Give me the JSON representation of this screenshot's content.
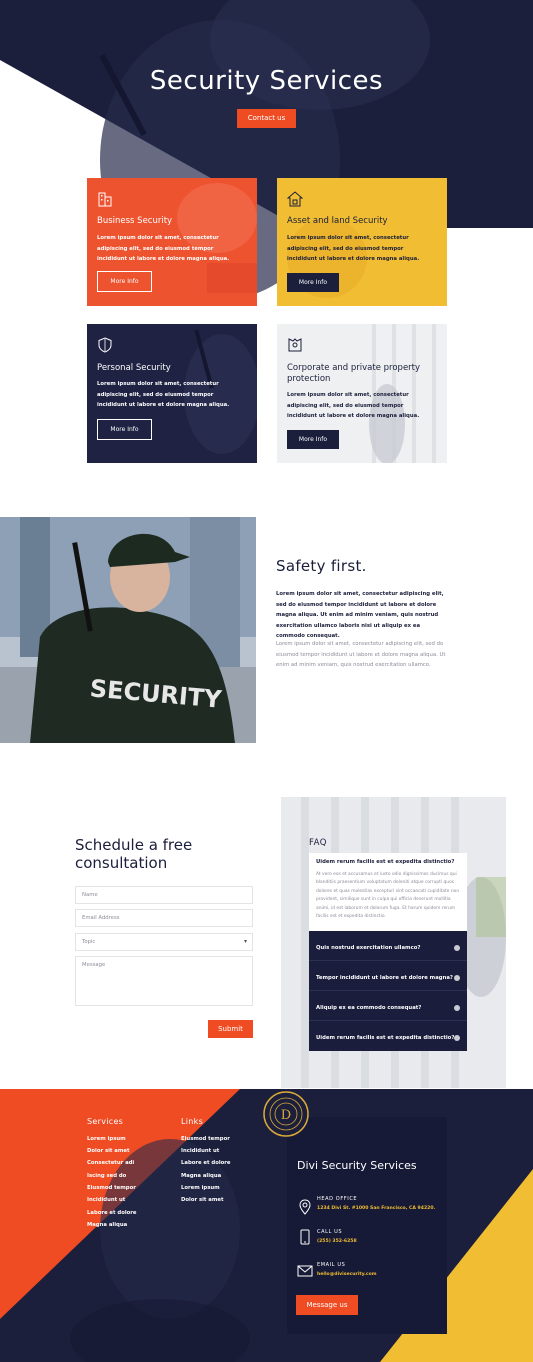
{
  "colors": {
    "navy": "#1b1f3b",
    "orange": "#ef4c24",
    "yellow": "#f1bd32",
    "light": "#eef0f2"
  },
  "hero": {
    "title": "Security Services",
    "button": "Contact us"
  },
  "services": [
    {
      "icon": "building-icon",
      "title": "Business Security",
      "text": "Lorem ipsum dolor sit amet, consectetur adipiscing elit, sed do eiusmod tempor incididunt ut labore et dolore magna aliqua.",
      "button": "More Info"
    },
    {
      "icon": "house-icon",
      "title": "Asset and land Security",
      "text": "Lorem ipsum dolor sit amet, consectetur adipiscing elit, sed do eiusmod tempor incididunt ut labore et dolore magna aliqua.",
      "button": "More Info"
    },
    {
      "icon": "shield-icon",
      "title": "Personal Security",
      "text": "Lorem ipsum dolor sit amet, consectetur adipiscing elit, sed do eiusmod tempor incididunt ut labore et dolore magna aliqua.",
      "button": "More Info"
    },
    {
      "icon": "guard-badge-icon",
      "title": "Corporate and private property protection",
      "text": "Lorem ipsum dolor sit amet, consectetur adipiscing elit, sed do eiusmod tempor incididunt ut labore et dolore magna aliqua.",
      "button": "More Info"
    }
  ],
  "safety": {
    "title": "Safety first.",
    "bold_text": "Lorem ipsum dolor sit amet, consectetur adipiscing elit, sed do eiusmod tempor incididunt ut labore et dolore magna aliqua. Ut enim ad minim veniam, quis nostrud exercitation ullamco laboris nisi ut aliquip ex ea commodo consequat.",
    "light_text": "Lorem ipsum dolor sit amet, consectetur adipiscing elit, sed do eiusmod tempor incididunt ut labore et dolore magna aliqua. Ut enim ad minim veniam, quis nostrud exercitation ullamco.",
    "photo_text": "SECURITY"
  },
  "consultation": {
    "title": "Schedule a free consultation",
    "name_placeholder": "Name",
    "email_placeholder": "Email Address",
    "topic_placeholder": "Topic",
    "message_placeholder": "Message",
    "submit": "Submit"
  },
  "faq": {
    "title": "FAQ",
    "open_question": "Uidem rerum facilis est et expedita distinctio?",
    "open_answer": "At vero eos et accusamus et iusto odio dignissimos ducimus qui blanditiis praesentium voluptatum deleniti atque corrupti quos dolores et quas molestias excepturi sint occaecati cupiditate non provident, similique sunt in culpa qui officia deserunt mollitia animi, id est laborum et dolorum fuga. Et harum quidem rerum facilis est et expedita distinctio.",
    "items": [
      "Quis nostrud exercitation ullamco?",
      "Tempor incididunt ut labore et dolore magna?",
      "Aliquip ex ea commodo consequat?",
      "Uidem rerum facilis est et expedita distinctio?"
    ]
  },
  "footer": {
    "services_title": "Services",
    "services": [
      "Lorem ipsum",
      "Dolor sit amet",
      "Consectetur adi",
      "Iscing sed do",
      "Eiusmod tempor",
      "Incididunt ut",
      "Labore et dolore",
      "Magna aliqua"
    ],
    "links_title": "Links",
    "links": [
      "Eiusmod tempor",
      "Incididunt ut",
      "Labore et dolore",
      "Magna aliqua",
      "Lorem ipsum",
      "Dolor sit amet"
    ],
    "emblem_letter": "D",
    "company": "Divi Security Services",
    "office_label": "HEAD OFFICE",
    "office_value": "1234 Divi St. #1000 San Francisco, CA 94220.",
    "call_label": "CALL US",
    "call_value": "(255) 352-6258",
    "email_label": "EMAIL US",
    "email_value": "hello@divisecurity.com",
    "button": "Message us"
  }
}
